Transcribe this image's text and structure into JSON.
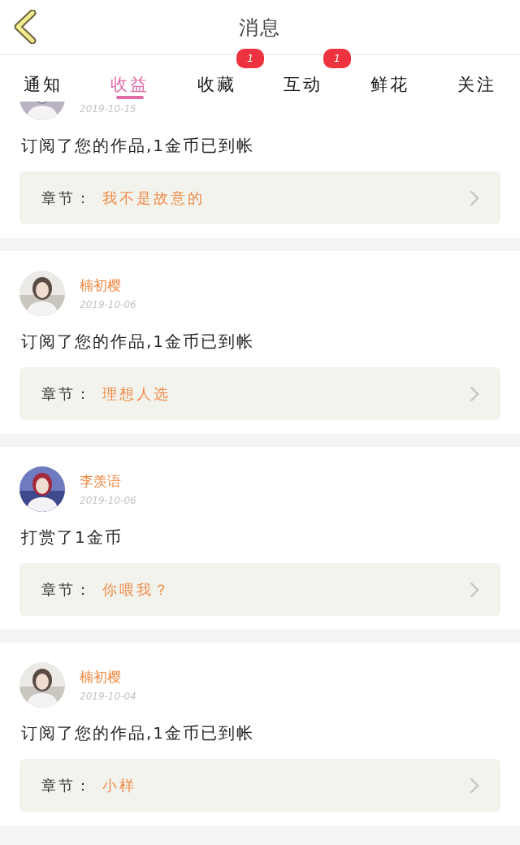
{
  "header": {
    "title": "消息"
  },
  "tabs": [
    {
      "label": "通知",
      "selected": false
    },
    {
      "label": "收益",
      "selected": true
    },
    {
      "label": "收藏",
      "selected": false,
      "badge": "1"
    },
    {
      "label": "互动",
      "selected": false,
      "badge": "1"
    },
    {
      "label": "鲜花",
      "selected": false
    },
    {
      "label": "关注",
      "selected": false
    }
  ],
  "messages": [
    {
      "date": "2019-10-15",
      "text": "订阅了您的作品,1金币已到帐",
      "chapter_label": "章节：",
      "chapter": "我不是故意的"
    },
    {
      "name": "楠初樱",
      "date": "2019-10-06",
      "text": "订阅了您的作品,1金币已到帐",
      "chapter_label": "章节：",
      "chapter": "理想人选"
    },
    {
      "name": "李羡语",
      "date": "2019-10-06",
      "text": "打赏了1金币",
      "chapter_label": "章节：",
      "chapter": "你喂我？"
    },
    {
      "name": "楠初樱",
      "date": "2019-10-04",
      "text": "订阅了您的作品,1金币已到帐",
      "chapter_label": "章节：",
      "chapter": "小样"
    }
  ]
}
